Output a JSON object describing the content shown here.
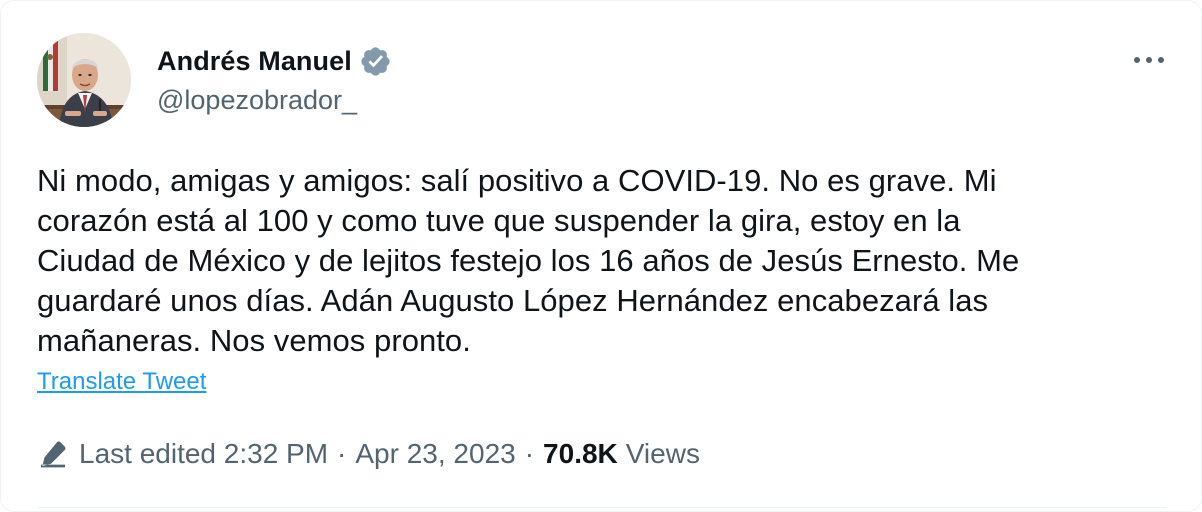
{
  "author": {
    "display_name": "Andrés Manuel",
    "handle": "@lopezobrador_",
    "verified": true,
    "avatar_icon": "profile-photo"
  },
  "tweet": {
    "lines": [
      "Ni modo, amigas y amigos: salí positivo a COVID-19. No es grave. Mi",
      "corazón está al 100 y como tuve que suspender la gira, estoy en la",
      "Ciudad de México y de lejitos festejo los 16 años de Jesús Ernesto. Me",
      "guardaré unos días. Adán Augusto López Hernández encabezará las",
      "mañaneras. Nos vemos pronto."
    ],
    "translate_label": "Translate Tweet"
  },
  "meta": {
    "edit_icon": "pencil-icon",
    "last_edited": "Last edited 2:32 PM",
    "separator": "·",
    "date": "Apr 23, 2023",
    "views_count": "70.8K",
    "views_label": "Views"
  },
  "more_icon": "more-horizontal-icon",
  "colors": {
    "text_primary": "#0f1419",
    "text_secondary": "#536471",
    "link": "#1d9bf0",
    "verified_badge": "#829aab",
    "border": "#eff3f4"
  }
}
